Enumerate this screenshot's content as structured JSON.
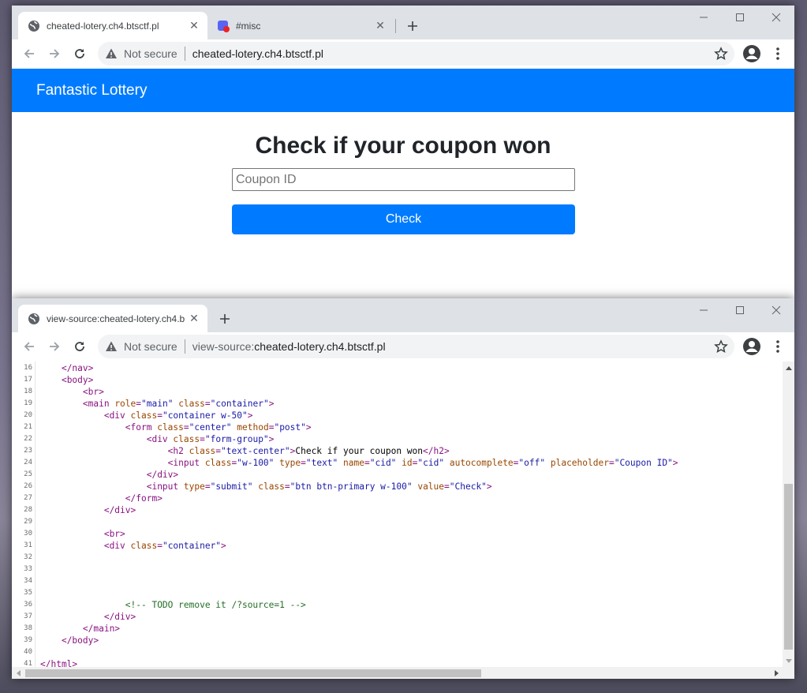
{
  "window_top": {
    "tabs": [
      {
        "title": "cheated-lotery.ch4.btsctf.pl"
      },
      {
        "title": "#misc"
      }
    ],
    "omnibox": {
      "security": "Not secure",
      "url": "cheated-lotery.ch4.btsctf.pl"
    },
    "page": {
      "brand": "Fantastic Lottery",
      "heading": "Check if your coupon won",
      "input_placeholder": "Coupon ID",
      "input_value": "",
      "button_label": "Check"
    }
  },
  "window_bottom": {
    "tabs": [
      {
        "title": "view-source:cheated-lotery.ch4.b"
      }
    ],
    "omnibox": {
      "security": "Not secure",
      "url_prefix": "view-source:",
      "url_host": "cheated-lotery.ch4.btsctf.pl"
    },
    "source_lines": [
      {
        "n": "16",
        "indent": "    ",
        "tokens": [
          [
            "tg",
            "</nav>"
          ]
        ]
      },
      {
        "n": "17",
        "indent": "    ",
        "tokens": [
          [
            "tg",
            "<body>"
          ]
        ]
      },
      {
        "n": "18",
        "indent": "        ",
        "tokens": [
          [
            "tg",
            "<br>"
          ]
        ]
      },
      {
        "n": "19",
        "indent": "        ",
        "tokens": [
          [
            "tg",
            "<main "
          ],
          [
            "an",
            "role"
          ],
          [
            "tg",
            "="
          ],
          [
            "av",
            "\"main\""
          ],
          [
            "tg",
            " "
          ],
          [
            "an",
            "class"
          ],
          [
            "tg",
            "="
          ],
          [
            "av",
            "\"container\""
          ],
          [
            "tg",
            ">"
          ]
        ]
      },
      {
        "n": "20",
        "indent": "            ",
        "tokens": [
          [
            "tg",
            "<div "
          ],
          [
            "an",
            "class"
          ],
          [
            "tg",
            "="
          ],
          [
            "av",
            "\"container w-50\""
          ],
          [
            "tg",
            ">"
          ]
        ]
      },
      {
        "n": "21",
        "indent": "                ",
        "tokens": [
          [
            "tg",
            "<form "
          ],
          [
            "an",
            "class"
          ],
          [
            "tg",
            "="
          ],
          [
            "av",
            "\"center\""
          ],
          [
            "tg",
            " "
          ],
          [
            "an",
            "method"
          ],
          [
            "tg",
            "="
          ],
          [
            "av",
            "\"post\""
          ],
          [
            "tg",
            ">"
          ]
        ]
      },
      {
        "n": "22",
        "indent": "                    ",
        "tokens": [
          [
            "tg",
            "<div "
          ],
          [
            "an",
            "class"
          ],
          [
            "tg",
            "="
          ],
          [
            "av",
            "\"form-group\""
          ],
          [
            "tg",
            ">"
          ]
        ]
      },
      {
        "n": "23",
        "indent": "                        ",
        "tokens": [
          [
            "tg",
            "<h2 "
          ],
          [
            "an",
            "class"
          ],
          [
            "tg",
            "="
          ],
          [
            "av",
            "\"text-center\""
          ],
          [
            "tg",
            ">"
          ],
          [
            "tx",
            "Check if your coupon won"
          ],
          [
            "tg",
            "</h2>"
          ]
        ]
      },
      {
        "n": "24",
        "indent": "                        ",
        "tokens": [
          [
            "tg",
            "<input "
          ],
          [
            "an",
            "class"
          ],
          [
            "tg",
            "="
          ],
          [
            "av",
            "\"w-100\""
          ],
          [
            "tg",
            " "
          ],
          [
            "an",
            "type"
          ],
          [
            "tg",
            "="
          ],
          [
            "av",
            "\"text\""
          ],
          [
            "tg",
            " "
          ],
          [
            "an",
            "name"
          ],
          [
            "tg",
            "="
          ],
          [
            "av",
            "\"cid\""
          ],
          [
            "tg",
            " "
          ],
          [
            "an",
            "id"
          ],
          [
            "tg",
            "="
          ],
          [
            "av",
            "\"cid\""
          ],
          [
            "tg",
            " "
          ],
          [
            "an",
            "autocomplete"
          ],
          [
            "tg",
            "="
          ],
          [
            "av",
            "\"off\""
          ],
          [
            "tg",
            " "
          ],
          [
            "an",
            "placeholder"
          ],
          [
            "tg",
            "="
          ],
          [
            "av",
            "\"Coupon ID\""
          ],
          [
            "tg",
            ">"
          ]
        ]
      },
      {
        "n": "25",
        "indent": "                    ",
        "tokens": [
          [
            "tg",
            "</div>"
          ]
        ]
      },
      {
        "n": "26",
        "indent": "                    ",
        "tokens": [
          [
            "tg",
            "<input "
          ],
          [
            "an",
            "type"
          ],
          [
            "tg",
            "="
          ],
          [
            "av",
            "\"submit\""
          ],
          [
            "tg",
            " "
          ],
          [
            "an",
            "class"
          ],
          [
            "tg",
            "="
          ],
          [
            "av",
            "\"btn btn-primary w-100\""
          ],
          [
            "tg",
            " "
          ],
          [
            "an",
            "value"
          ],
          [
            "tg",
            "="
          ],
          [
            "av",
            "\"Check\""
          ],
          [
            "tg",
            ">"
          ]
        ]
      },
      {
        "n": "27",
        "indent": "                ",
        "tokens": [
          [
            "tg",
            "</form>"
          ]
        ]
      },
      {
        "n": "28",
        "indent": "            ",
        "tokens": [
          [
            "tg",
            "</div>"
          ]
        ]
      },
      {
        "n": "29",
        "indent": "",
        "tokens": []
      },
      {
        "n": "30",
        "indent": "            ",
        "tokens": [
          [
            "tg",
            "<br>"
          ]
        ]
      },
      {
        "n": "31",
        "indent": "            ",
        "tokens": [
          [
            "tg",
            "<div "
          ],
          [
            "an",
            "class"
          ],
          [
            "tg",
            "="
          ],
          [
            "av",
            "\"container\""
          ],
          [
            "tg",
            ">"
          ]
        ]
      },
      {
        "n": "32",
        "indent": "",
        "tokens": []
      },
      {
        "n": "33",
        "indent": "",
        "tokens": []
      },
      {
        "n": "34",
        "indent": "",
        "tokens": []
      },
      {
        "n": "35",
        "indent": "",
        "tokens": []
      },
      {
        "n": "36",
        "indent": "                ",
        "tokens": [
          [
            "cm",
            "<!-- TODO remove it /?source=1 -->"
          ]
        ]
      },
      {
        "n": "37",
        "indent": "            ",
        "tokens": [
          [
            "tg",
            "</div>"
          ]
        ]
      },
      {
        "n": "38",
        "indent": "        ",
        "tokens": [
          [
            "tg",
            "</main>"
          ]
        ]
      },
      {
        "n": "39",
        "indent": "    ",
        "tokens": [
          [
            "tg",
            "</body>"
          ]
        ]
      },
      {
        "n": "40",
        "indent": "",
        "tokens": []
      },
      {
        "n": "41",
        "indent": "",
        "tokens": [
          [
            "tg",
            "</html>"
          ]
        ]
      }
    ]
  }
}
